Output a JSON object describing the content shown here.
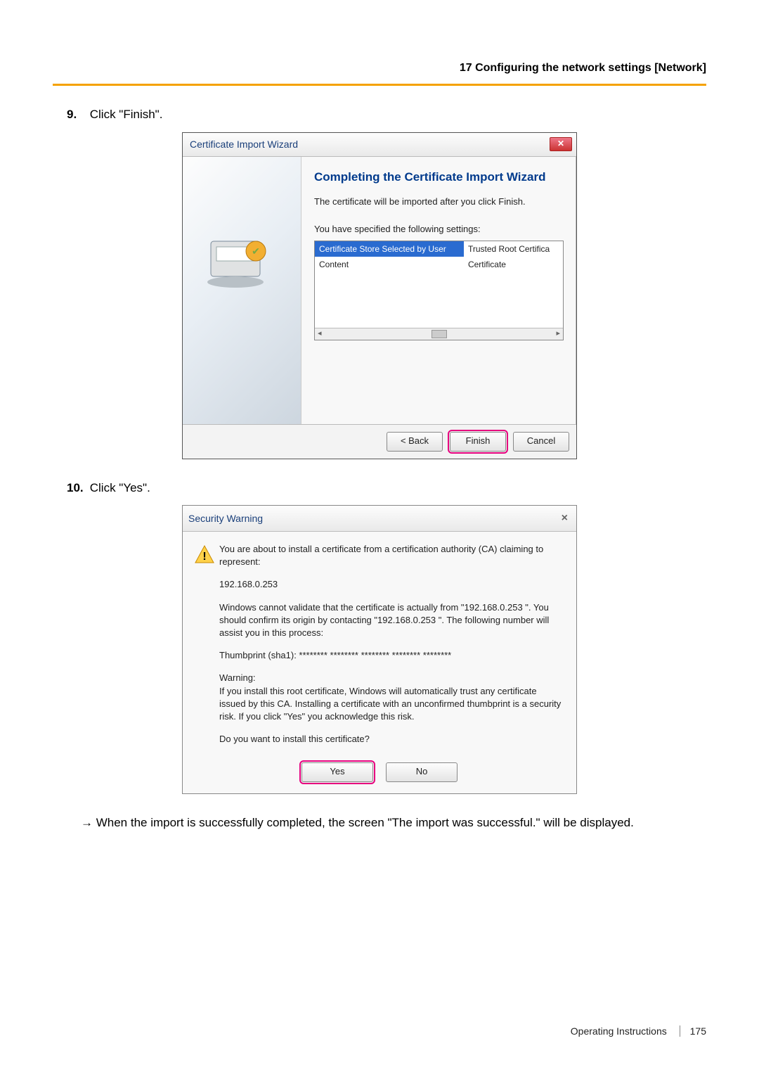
{
  "header": "17 Configuring the network settings [Network]",
  "step9": {
    "num": "9.",
    "text": "Click \"Finish\"."
  },
  "wizard": {
    "title": "Certificate Import Wizard",
    "heading": "Completing the Certificate Import Wizard",
    "line1": "The certificate will be imported after you click Finish.",
    "line2": "You have specified the following settings:",
    "rows": [
      {
        "c1": "Certificate Store Selected by User",
        "c2": "Trusted Root Certifica"
      },
      {
        "c1": "Content",
        "c2": "Certificate"
      }
    ],
    "btn_back": "< Back",
    "btn_finish": "Finish",
    "btn_cancel": "Cancel"
  },
  "step10": {
    "num": "10.",
    "text": "Click \"Yes\"."
  },
  "warn": {
    "title": "Security Warning",
    "p1": "You are about to install a certificate from a certification authority (CA) claiming to represent:",
    "p2": "192.168.0.253",
    "p3": "Windows cannot validate that the certificate is actually from \"192.168.0.253 \". You should confirm its origin by contacting \"192.168.0.253 \". The following number will assist you in this process:",
    "p4": "Thumbprint (sha1): ******** ******** ******** ******** ********",
    "p5a": "Warning:",
    "p5b": "If you install this root certificate, Windows will automatically trust any certificate issued by this CA. Installing a certificate with an unconfirmed thumbprint is a security risk. If you click \"Yes\" you acknowledge this risk.",
    "p6": "Do you want to install this certificate?",
    "btn_yes": "Yes",
    "btn_no": "No"
  },
  "result_note": "→  When the import is successfully completed, the screen \"The import was successful.\" will be displayed.",
  "footer": {
    "label": "Operating Instructions",
    "page": "175"
  }
}
